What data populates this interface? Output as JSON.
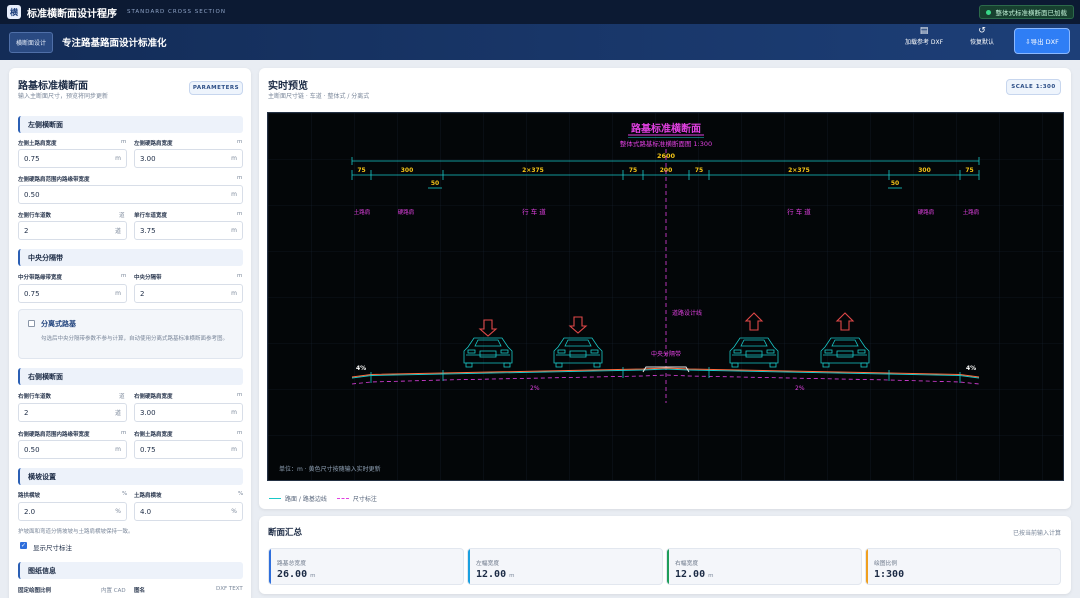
{
  "app": {
    "logo": "横",
    "title": "标准横断面设计程序",
    "subtitle": "STANDARD CROSS SECTION",
    "status": "整体式标准横断面已加载"
  },
  "header": {
    "chip": "横断面设计",
    "tagline": "专注路基路面设计标准化",
    "load_dxf": "加载参考 DXF",
    "reset": "恢复默认",
    "export": "⇩导出 DXF"
  },
  "left": {
    "title": "路基标准横断面",
    "subtitle": "输入主断面尺寸，预览将同步更新",
    "badge": "PARAMETERS",
    "sec_left": "左侧横断面",
    "l_earth_label": "左侧土路肩宽度",
    "l_earth_unit": "m",
    "l_earth_value": "0.75",
    "l_earth_u": "m",
    "l_hard_label": "左侧硬路肩宽度",
    "l_hard_unit": "m",
    "l_hard_value": "3.00",
    "l_hard_u": "m",
    "l_mark_label": "左侧硬路肩范围内路缘带宽度",
    "l_mark_unit": "m",
    "l_mark_value": "0.50",
    "l_mark_u": "m",
    "l_lanes_label": "左侧行车道数",
    "l_lanes_unit": "道",
    "l_lanes_value": "2",
    "l_lanes_u": "道",
    "lane_width_label": "单行车道宽度",
    "lane_width_unit": "m",
    "lane_width_value": "3.75",
    "lane_width_u": "m",
    "sec_median": "中央分隔带",
    "med_strip_label": "中分带路缘带宽度",
    "med_strip_unit": "m",
    "med_strip_value": "0.75",
    "med_strip_u": "m",
    "med_label": "中央分隔带",
    "med_unit": "m",
    "med_value": "2",
    "med_u": "m",
    "split_title": "分离式路基",
    "split_desc": "勾选后中央分隔带参数不参与计算，自动使用分离式路基标准横断面参考图。",
    "sec_right": "右侧横断面",
    "r_lanes_label": "右侧行车道数",
    "r_lanes_unit": "道",
    "r_lanes_value": "2",
    "r_lanes_u": "道",
    "r_hard_label": "右侧硬路肩宽度",
    "r_hard_unit": "m",
    "r_hard_value": "3.00",
    "r_hard_u": "m",
    "r_mark_label": "右侧硬路肩范围内路缘带宽度",
    "r_mark_unit": "m",
    "r_mark_value": "0.50",
    "r_mark_u": "m",
    "r_earth_label": "右侧土路肩宽度",
    "r_earth_unit": "m",
    "r_earth_value": "0.75",
    "r_earth_u": "m",
    "sec_slope": "横坡设置",
    "road_slope_label": "路拱横坡",
    "road_slope_unit": "%",
    "road_slope_value": "2.0",
    "road_slope_u": "%",
    "earth_slope_label": "土路肩横坡",
    "earth_slope_unit": "%",
    "earth_slope_value": "4.0",
    "earth_slope_u": "%",
    "slope_note": "护坡面和弯道分情坡坡与土路肩横坡保持一致。",
    "show_dims": "显示尺寸标注",
    "sec_sheet": "图纸信息",
    "sheet_scale_label": "固定绘图比例",
    "sheet_scale_unit": "内置 CAD",
    "sheet_name_label": "图名",
    "sheet_name_unit": "DXF TEXT"
  },
  "preview": {
    "title": "实时预览",
    "subtitle": "主断面尺寸链 · 车道 · 整体式 / 分离式",
    "scale_badge": "SCALE 1:300",
    "legend_road": "路面 / 路基边线",
    "legend_dim": "尺寸标注"
  },
  "drawing": {
    "title": "路基标准横断面",
    "subtitle": "整体式路基标准横断面图   1:300",
    "total": "2600",
    "dims": [
      "75",
      "300",
      "2×375",
      "75",
      "200",
      "75",
      "2×375",
      "300",
      "75"
    ],
    "curb_dims": [
      "50",
      "50"
    ],
    "zone_labels": [
      "土路肩",
      "硬路肩",
      "行 车 道",
      "行 车 道",
      "硬路肩",
      "土路肩"
    ],
    "centerline_label": "道路设计线",
    "median_label": "中央分隔带",
    "slope_left": "4%",
    "slope_right": "4%",
    "slope_mid_left": "2%",
    "slope_mid_right": "2%",
    "footer": "单位：m  ·  黄色尺寸按随输入实时更新"
  },
  "summary": {
    "title": "断面汇总",
    "hint": "已按当前输入计算",
    "cards": [
      {
        "label": "路基总宽度",
        "value": "26.00",
        "unit": "m",
        "color": "#2f6fdc"
      },
      {
        "label": "左幅宽度",
        "value": "12.00",
        "unit": "m",
        "color": "#1aa0e0"
      },
      {
        "label": "右幅宽度",
        "value": "12.00",
        "unit": "m",
        "color": "#1f9e5a"
      },
      {
        "label": "绘图比例",
        "value": "1:300",
        "unit": "",
        "color": "#f0a020"
      }
    ]
  },
  "colors": {
    "road": "#19c8c8",
    "dimension": "#e040e0",
    "dim_text": "#f5c518",
    "accent": "#2f6fdc"
  }
}
